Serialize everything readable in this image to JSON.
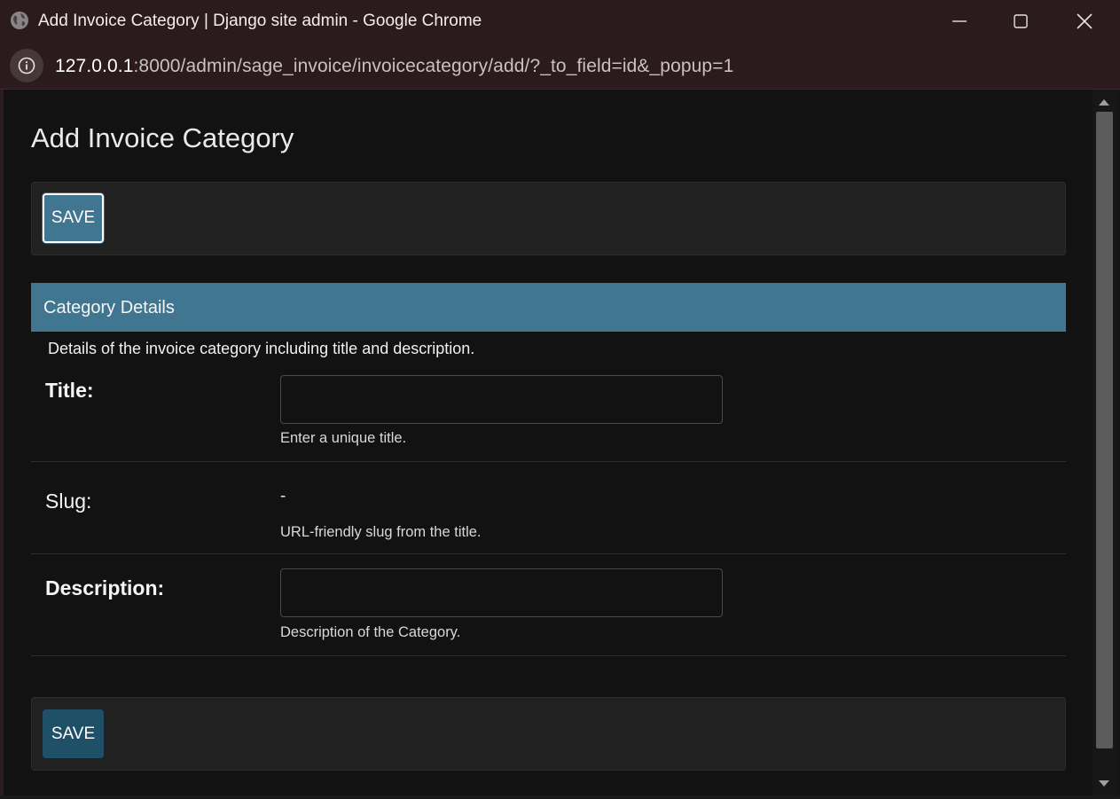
{
  "window": {
    "title": "Add Invoice Category | Django site admin - Google Chrome",
    "icons": [
      "globe-icon",
      "minimize-icon",
      "maximize-icon",
      "close-icon"
    ]
  },
  "addressbar": {
    "host": "127.0.0.1",
    "path": ":8000/admin/sage_invoice/invoicecategory/add/?_to_field=id&_popup=1",
    "info_icon": "info-icon"
  },
  "page": {
    "title": "Add Invoice Category",
    "save_top_label": "SAVE",
    "save_bottom_label": "SAVE"
  },
  "fieldset": {
    "header": "Category Details",
    "description": "Details of the invoice category including title and description."
  },
  "fields": {
    "title": {
      "label": "Title:",
      "value": "",
      "help": "Enter a unique title."
    },
    "slug": {
      "label": "Slug:",
      "value": "-",
      "help": "URL-friendly slug from the title."
    },
    "description": {
      "label": "Description:",
      "value": "",
      "help": "Description of the Category."
    }
  },
  "colors": {
    "accent": "#417690",
    "save_button_dark": "#205067",
    "background": "#121212",
    "module": "#212121",
    "titlebar": "#2b1b1e"
  }
}
